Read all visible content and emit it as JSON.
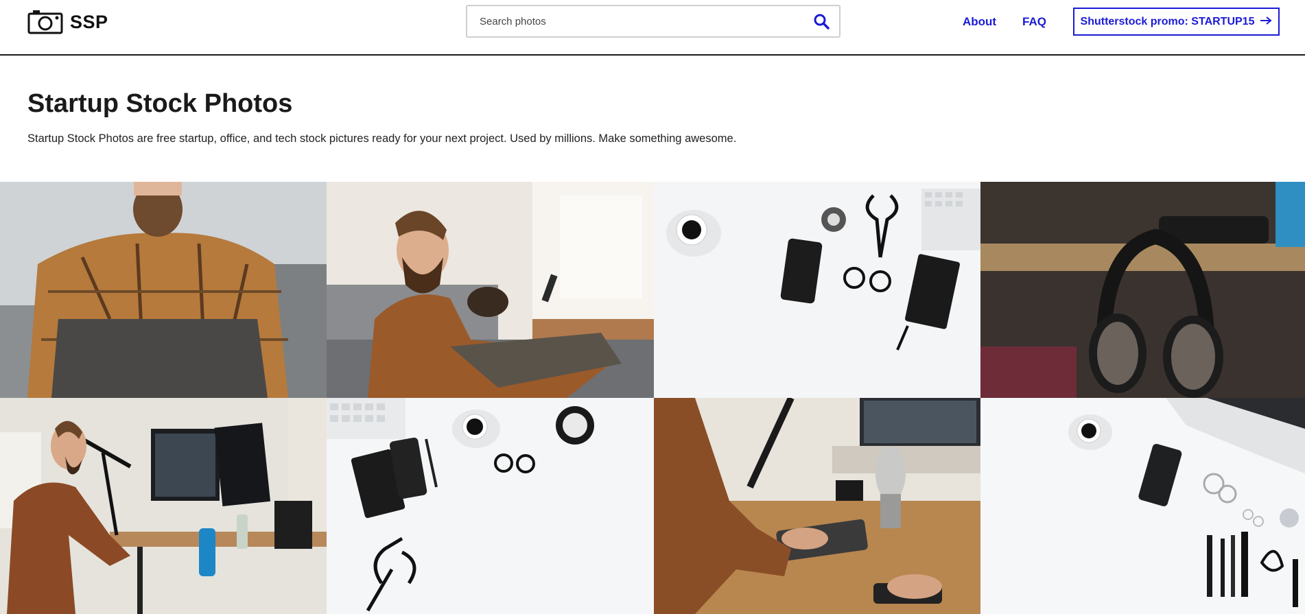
{
  "header": {
    "logo_text": "SSP",
    "logo_icon": "camera-icon",
    "search_placeholder": "Search photos",
    "search_icon": "search-icon",
    "nav": [
      {
        "label": "About"
      },
      {
        "label": "FAQ"
      }
    ],
    "promo_label": "Shutterstock promo: STARTUP15",
    "promo_icon": "arrow-right-icon",
    "accent_color": "#1a1ad6"
  },
  "hero": {
    "title": "Startup Stock Photos",
    "description": "Startup Stock Photos are free startup, office, and tech stock pictures ready for your next project. Used by millions. Make something awesome."
  },
  "gallery": {
    "photos": [
      {
        "subject": "man-laptop-couch"
      },
      {
        "subject": "man-phone-dog-couch"
      },
      {
        "subject": "desk-flatlay-phone-glasses"
      },
      {
        "subject": "headphones-desk"
      },
      {
        "subject": "man-standing-desk-monitors"
      },
      {
        "subject": "flatlay-notebook-clock"
      },
      {
        "subject": "microphone-keyboard"
      },
      {
        "subject": "flatlay-laptop-makeup"
      }
    ]
  }
}
